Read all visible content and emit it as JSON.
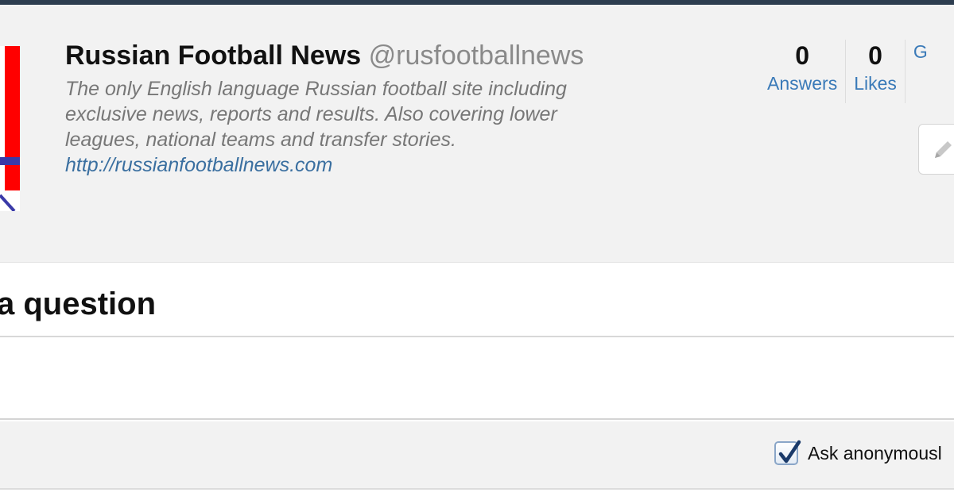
{
  "profile": {
    "display_name": "Russian Football News",
    "username": "@rusfootballnews",
    "bio": "The only English language Russian football site including exclusive news, reports and results. Also covering lower leagues, national teams and transfer stories.",
    "website": "http://russianfootballnews.com",
    "avatar_colors": {
      "primary": "#ff0000",
      "stripe": "#3a3aa8"
    }
  },
  "stats": [
    {
      "count": "0",
      "label": "Answers"
    },
    {
      "count": "0",
      "label": "Likes"
    },
    {
      "count": "",
      "label": "G"
    }
  ],
  "edit_button": {
    "icon": "pencil-icon"
  },
  "ask": {
    "title": "a question",
    "question_value": "",
    "anonymous_label": "Ask anonymousl",
    "anonymous_checked": true
  },
  "colors": {
    "top_bar": "#2d3e50",
    "link": "#3a7ab8",
    "header_bg": "#f2f2f2"
  }
}
